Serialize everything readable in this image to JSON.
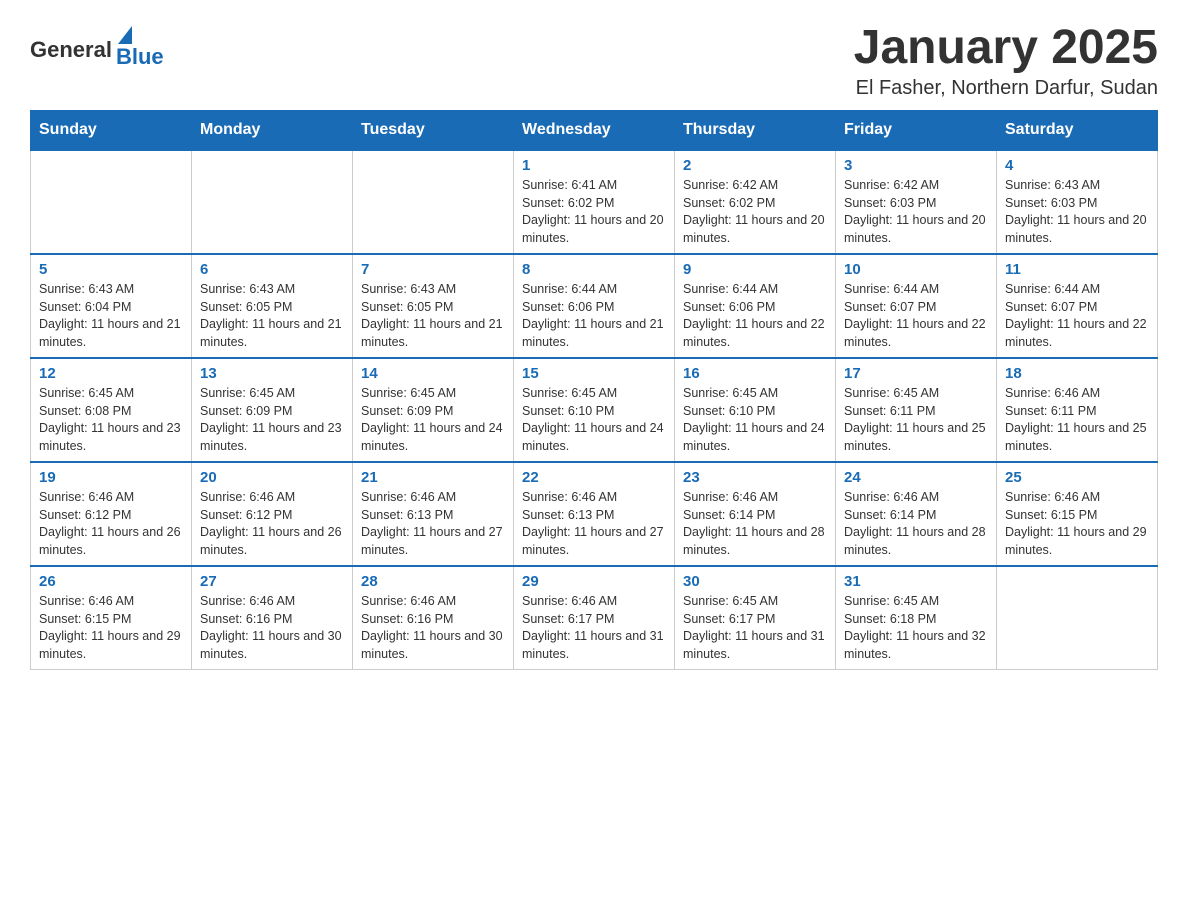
{
  "header": {
    "logo_general": "General",
    "logo_blue": "Blue",
    "month_year": "January 2025",
    "location": "El Fasher, Northern Darfur, Sudan"
  },
  "weekdays": [
    "Sunday",
    "Monday",
    "Tuesday",
    "Wednesday",
    "Thursday",
    "Friday",
    "Saturday"
  ],
  "weeks": [
    {
      "days": [
        {
          "num": "",
          "info": ""
        },
        {
          "num": "",
          "info": ""
        },
        {
          "num": "",
          "info": ""
        },
        {
          "num": "1",
          "info": "Sunrise: 6:41 AM\nSunset: 6:02 PM\nDaylight: 11 hours and 20 minutes."
        },
        {
          "num": "2",
          "info": "Sunrise: 6:42 AM\nSunset: 6:02 PM\nDaylight: 11 hours and 20 minutes."
        },
        {
          "num": "3",
          "info": "Sunrise: 6:42 AM\nSunset: 6:03 PM\nDaylight: 11 hours and 20 minutes."
        },
        {
          "num": "4",
          "info": "Sunrise: 6:43 AM\nSunset: 6:03 PM\nDaylight: 11 hours and 20 minutes."
        }
      ]
    },
    {
      "days": [
        {
          "num": "5",
          "info": "Sunrise: 6:43 AM\nSunset: 6:04 PM\nDaylight: 11 hours and 21 minutes."
        },
        {
          "num": "6",
          "info": "Sunrise: 6:43 AM\nSunset: 6:05 PM\nDaylight: 11 hours and 21 minutes."
        },
        {
          "num": "7",
          "info": "Sunrise: 6:43 AM\nSunset: 6:05 PM\nDaylight: 11 hours and 21 minutes."
        },
        {
          "num": "8",
          "info": "Sunrise: 6:44 AM\nSunset: 6:06 PM\nDaylight: 11 hours and 21 minutes."
        },
        {
          "num": "9",
          "info": "Sunrise: 6:44 AM\nSunset: 6:06 PM\nDaylight: 11 hours and 22 minutes."
        },
        {
          "num": "10",
          "info": "Sunrise: 6:44 AM\nSunset: 6:07 PM\nDaylight: 11 hours and 22 minutes."
        },
        {
          "num": "11",
          "info": "Sunrise: 6:44 AM\nSunset: 6:07 PM\nDaylight: 11 hours and 22 minutes."
        }
      ]
    },
    {
      "days": [
        {
          "num": "12",
          "info": "Sunrise: 6:45 AM\nSunset: 6:08 PM\nDaylight: 11 hours and 23 minutes."
        },
        {
          "num": "13",
          "info": "Sunrise: 6:45 AM\nSunset: 6:09 PM\nDaylight: 11 hours and 23 minutes."
        },
        {
          "num": "14",
          "info": "Sunrise: 6:45 AM\nSunset: 6:09 PM\nDaylight: 11 hours and 24 minutes."
        },
        {
          "num": "15",
          "info": "Sunrise: 6:45 AM\nSunset: 6:10 PM\nDaylight: 11 hours and 24 minutes."
        },
        {
          "num": "16",
          "info": "Sunrise: 6:45 AM\nSunset: 6:10 PM\nDaylight: 11 hours and 24 minutes."
        },
        {
          "num": "17",
          "info": "Sunrise: 6:45 AM\nSunset: 6:11 PM\nDaylight: 11 hours and 25 minutes."
        },
        {
          "num": "18",
          "info": "Sunrise: 6:46 AM\nSunset: 6:11 PM\nDaylight: 11 hours and 25 minutes."
        }
      ]
    },
    {
      "days": [
        {
          "num": "19",
          "info": "Sunrise: 6:46 AM\nSunset: 6:12 PM\nDaylight: 11 hours and 26 minutes."
        },
        {
          "num": "20",
          "info": "Sunrise: 6:46 AM\nSunset: 6:12 PM\nDaylight: 11 hours and 26 minutes."
        },
        {
          "num": "21",
          "info": "Sunrise: 6:46 AM\nSunset: 6:13 PM\nDaylight: 11 hours and 27 minutes."
        },
        {
          "num": "22",
          "info": "Sunrise: 6:46 AM\nSunset: 6:13 PM\nDaylight: 11 hours and 27 minutes."
        },
        {
          "num": "23",
          "info": "Sunrise: 6:46 AM\nSunset: 6:14 PM\nDaylight: 11 hours and 28 minutes."
        },
        {
          "num": "24",
          "info": "Sunrise: 6:46 AM\nSunset: 6:14 PM\nDaylight: 11 hours and 28 minutes."
        },
        {
          "num": "25",
          "info": "Sunrise: 6:46 AM\nSunset: 6:15 PM\nDaylight: 11 hours and 29 minutes."
        }
      ]
    },
    {
      "days": [
        {
          "num": "26",
          "info": "Sunrise: 6:46 AM\nSunset: 6:15 PM\nDaylight: 11 hours and 29 minutes."
        },
        {
          "num": "27",
          "info": "Sunrise: 6:46 AM\nSunset: 6:16 PM\nDaylight: 11 hours and 30 minutes."
        },
        {
          "num": "28",
          "info": "Sunrise: 6:46 AM\nSunset: 6:16 PM\nDaylight: 11 hours and 30 minutes."
        },
        {
          "num": "29",
          "info": "Sunrise: 6:46 AM\nSunset: 6:17 PM\nDaylight: 11 hours and 31 minutes."
        },
        {
          "num": "30",
          "info": "Sunrise: 6:45 AM\nSunset: 6:17 PM\nDaylight: 11 hours and 31 minutes."
        },
        {
          "num": "31",
          "info": "Sunrise: 6:45 AM\nSunset: 6:18 PM\nDaylight: 11 hours and 32 minutes."
        },
        {
          "num": "",
          "info": ""
        }
      ]
    }
  ]
}
